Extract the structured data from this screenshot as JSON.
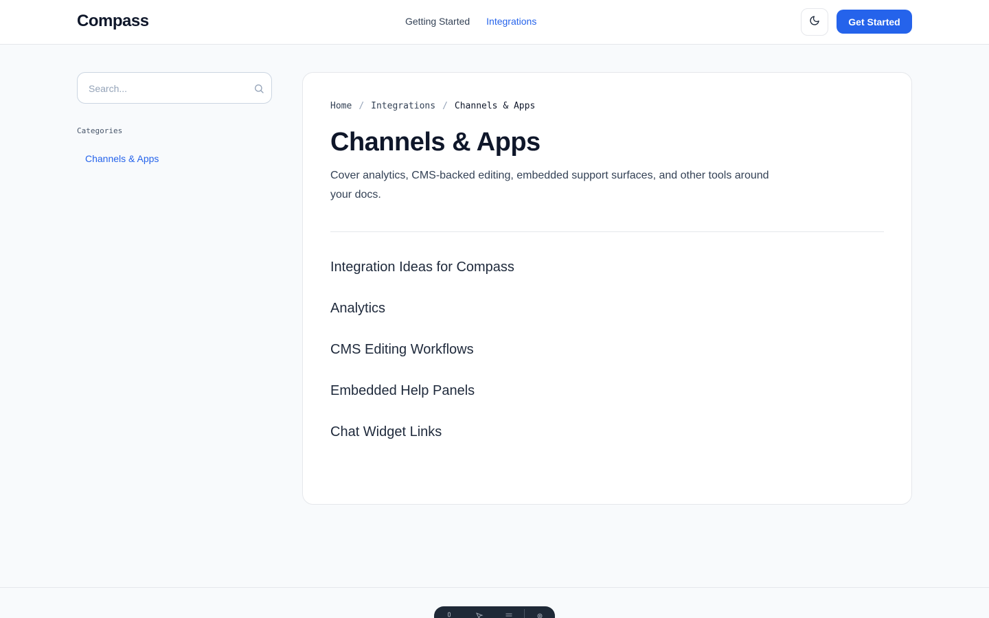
{
  "header": {
    "brand": "Compass",
    "nav": [
      {
        "label": "Getting Started",
        "active": false
      },
      {
        "label": "Integrations",
        "active": true
      }
    ],
    "theme_toggle_icon": "moon-icon",
    "cta_label": "Get Started"
  },
  "sidebar": {
    "search_placeholder": "Search...",
    "categories_heading": "Categories",
    "items": [
      {
        "label": "Channels & Apps",
        "active": true
      }
    ]
  },
  "main": {
    "breadcrumb": [
      "Home",
      "Integrations",
      "Channels & Apps"
    ],
    "title": "Channels & Apps",
    "description": "Cover analytics, CMS-backed editing, embedded support surfaces, and other tools around your docs.",
    "sections": [
      "Integration Ideas for Compass",
      "Analytics",
      "CMS Editing Workflows",
      "Embedded Help Panels",
      "Chat Widget Links"
    ]
  },
  "colors": {
    "accent": "#2563eb",
    "background": "#f8fafc",
    "card": "#ffffff",
    "text": "#0f172a"
  }
}
